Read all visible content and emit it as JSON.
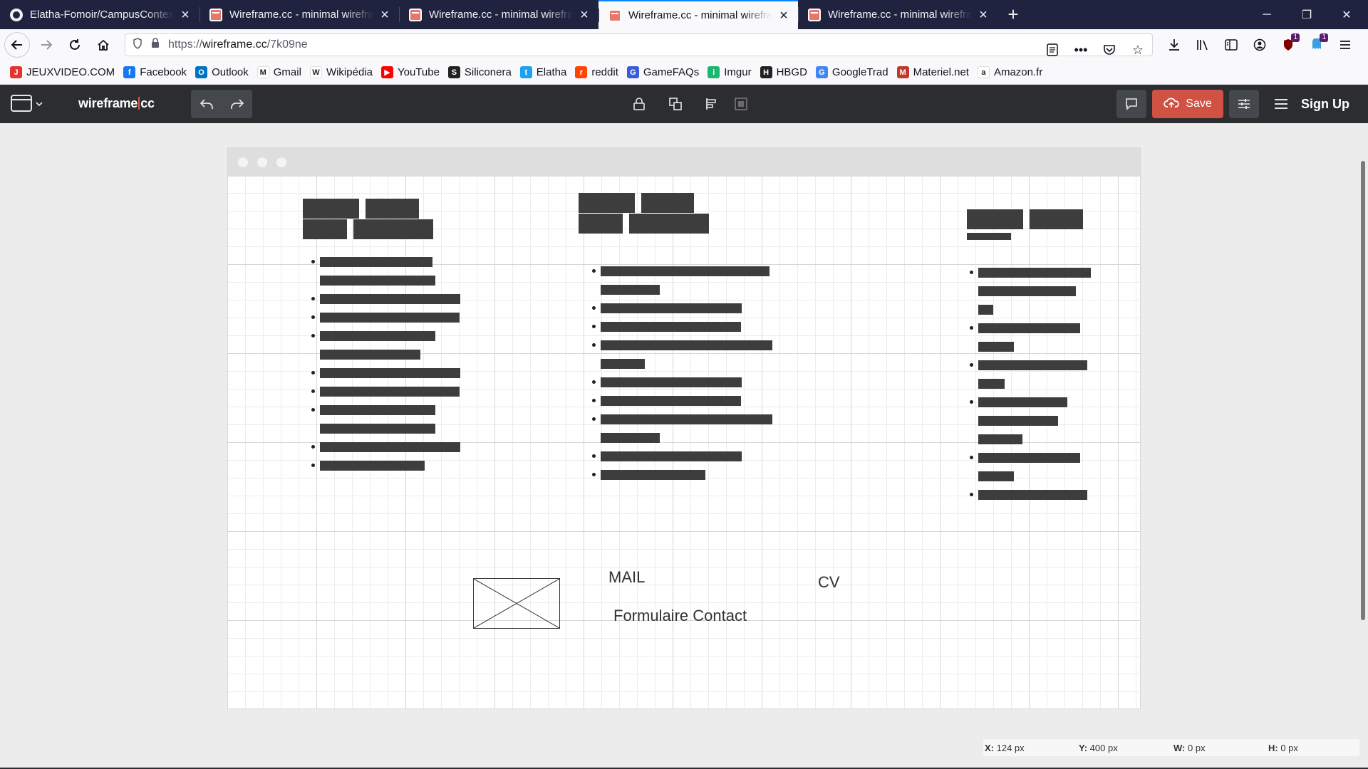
{
  "browser": {
    "tabs": [
      {
        "title": "Elatha-Fomoir/CampusContest: ",
        "favicon": "github-icon",
        "active": false
      },
      {
        "title": "Wireframe.cc - minimal wirefra",
        "favicon": "wireframe-icon",
        "active": false
      },
      {
        "title": "Wireframe.cc - minimal wirefra",
        "favicon": "wireframe-icon",
        "active": false
      },
      {
        "title": "Wireframe.cc - minimal wirefra",
        "favicon": "wireframe-icon",
        "active": true
      },
      {
        "title": "Wireframe.cc - minimal wirefra",
        "favicon": "wireframe-icon",
        "active": false
      }
    ],
    "url_prefix": "https://",
    "url_host": "wireframe.cc",
    "url_path": "/7k09ne",
    "badges": {
      "ublock": "1",
      "extension": "1"
    },
    "bookmarks": [
      {
        "label": "JEUXVIDEO.COM",
        "color": "#e3342f",
        "glyph": "J"
      },
      {
        "label": "Facebook",
        "color": "#1877f2",
        "glyph": "f"
      },
      {
        "label": "Outlook",
        "color": "#0072c6",
        "glyph": "O"
      },
      {
        "label": "Gmail",
        "color": "#ffffff",
        "glyph": "M"
      },
      {
        "label": "Wikipédia",
        "color": "#ffffff",
        "glyph": "W"
      },
      {
        "label": "YouTube",
        "color": "#ff0000",
        "glyph": "▶"
      },
      {
        "label": "Siliconera",
        "color": "#222222",
        "glyph": "S"
      },
      {
        "label": "Elatha",
        "color": "#1da1f2",
        "glyph": "t"
      },
      {
        "label": "reddit",
        "color": "#ff4500",
        "glyph": "r"
      },
      {
        "label": "GameFAQs",
        "color": "#3b5bdb",
        "glyph": "G"
      },
      {
        "label": "Imgur",
        "color": "#1bb76e",
        "glyph": "i"
      },
      {
        "label": "HBGD",
        "color": "#222222",
        "glyph": "H"
      },
      {
        "label": "GoogleTrad",
        "color": "#4285f4",
        "glyph": "G"
      },
      {
        "label": "Materiel.net",
        "color": "#c0392b",
        "glyph": "M"
      },
      {
        "label": "Amazon.fr",
        "color": "#ffffff",
        "glyph": "a"
      }
    ]
  },
  "app": {
    "logo_left": "wireframe",
    "logo_right": "cc",
    "save_label": "Save",
    "signup_label": "Sign Up",
    "accent": "#cf5245"
  },
  "wireframe": {
    "texts": {
      "mail": "MAIL",
      "cv": "CV",
      "contact": "Formulaire Contact"
    }
  },
  "status": {
    "x_label": "X:",
    "x_value": "124 px",
    "y_label": "Y:",
    "y_value": "400 px",
    "w_label": "W:",
    "w_value": "0 px",
    "h_label": "H:",
    "h_value": "0 px"
  }
}
